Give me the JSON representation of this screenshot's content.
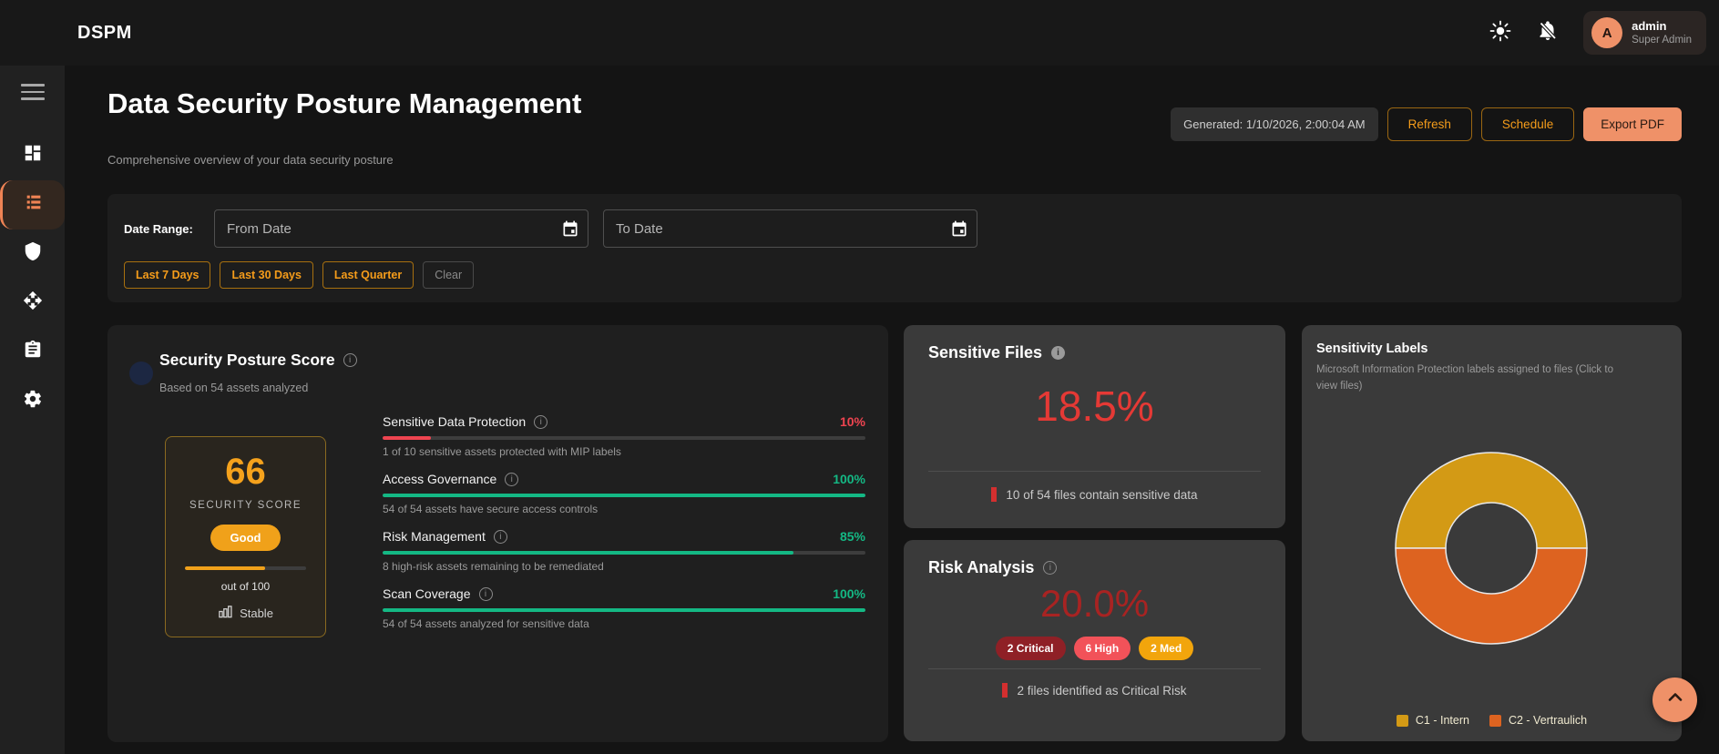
{
  "topbar": {
    "brand": "DSPM",
    "user": {
      "initial": "A",
      "name": "admin",
      "role": "Super Admin"
    }
  },
  "sidebar": {
    "items": [
      {
        "icon": "dashboard-icon",
        "active": false
      },
      {
        "icon": "report-list-icon",
        "active": true
      },
      {
        "icon": "shield-icon",
        "active": false
      },
      {
        "icon": "move-icon",
        "active": false
      },
      {
        "icon": "clipboard-icon",
        "active": false
      },
      {
        "icon": "gear-icon",
        "active": false
      }
    ]
  },
  "header": {
    "title": "Data Security Posture Management",
    "subtitle": "Comprehensive overview of your data security posture",
    "generated": "Generated: 1/10/2026, 2:00:04 AM",
    "refresh_label": "Refresh",
    "schedule_label": "Schedule",
    "export_label": "Export PDF"
  },
  "filters": {
    "label": "Date Range:",
    "from_placeholder": "From Date",
    "to_placeholder": "To Date",
    "presets": [
      "Last 7 Days",
      "Last 30 Days",
      "Last Quarter"
    ],
    "clear_label": "Clear"
  },
  "score_card": {
    "title": "Security Posture Score",
    "subtitle": "Based on 54 assets analyzed",
    "score": "66",
    "score_percent": 66,
    "score_label": "SECURITY SCORE",
    "rating": "Good",
    "out_of": "out of 100",
    "trend": "Stable",
    "metrics": [
      {
        "label": "Sensitive Data Protection",
        "value": "10%",
        "percent": 10,
        "color": "#ef4450",
        "desc": "1 of 10 sensitive assets protected with MIP labels"
      },
      {
        "label": "Access Governance",
        "value": "100%",
        "percent": 100,
        "color": "#14b884",
        "desc": "54 of 54 assets have secure access controls"
      },
      {
        "label": "Risk Management",
        "value": "85%",
        "percent": 85,
        "color": "#14b884",
        "desc": "8 high-risk assets remaining to be remediated"
      },
      {
        "label": "Scan Coverage",
        "value": "100%",
        "percent": 100,
        "color": "#14b884",
        "desc": "54 of 54 assets analyzed for sensitive data"
      }
    ]
  },
  "sensitive_files": {
    "title": "Sensitive Files",
    "value": "18.5%",
    "color": "#e53935",
    "caption": "10 of 54 files contain sensitive data"
  },
  "risk_analysis": {
    "title": "Risk Analysis",
    "value": "20.0%",
    "color": "#a82322",
    "badges": [
      {
        "label": "2 Critical",
        "color": "#8f2026"
      },
      {
        "label": "6 High",
        "color": "#f25259"
      },
      {
        "label": "2 Med",
        "color": "#f2a50c"
      }
    ],
    "caption": "2 files identified as Critical Risk"
  },
  "sensitivity_labels": {
    "title": "Sensitivity Labels",
    "subtitle": "Microsoft Information Protection labels assigned to files (Click to view files)",
    "chart_data": {
      "type": "pie",
      "donut": true,
      "labels": [
        "C1 - Intern",
        "C2 - Vertraulich"
      ],
      "values": [
        50,
        50
      ],
      "unit": "percent",
      "colors": [
        "#d39a15",
        "#dd6320"
      ],
      "legend_position": "bottom"
    }
  },
  "colors": {
    "accent_orange": "#f59c1a",
    "salmon": "#ef9168",
    "status_red": "#e53935",
    "status_dark_red": "#a82322",
    "status_green": "#14b884"
  }
}
